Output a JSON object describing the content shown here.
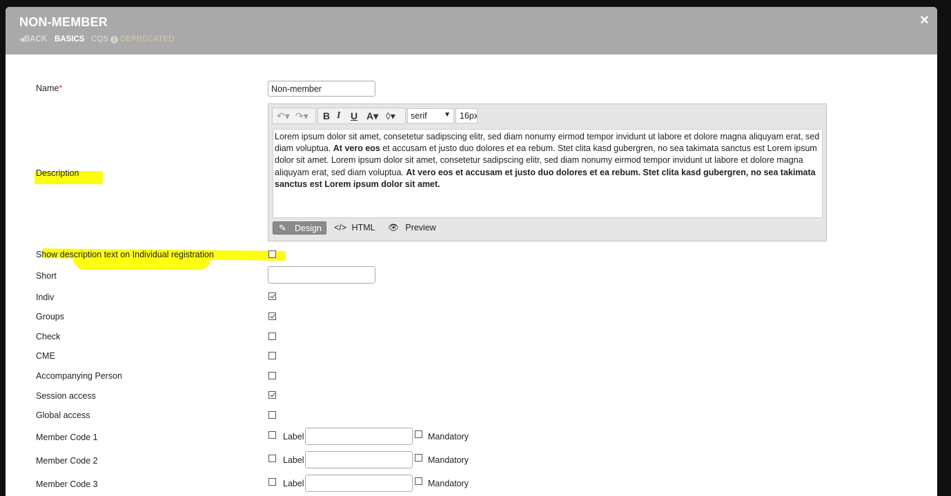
{
  "modal": {
    "title": "NON-MEMBER",
    "close_symbol": "×",
    "nav": {
      "back": "BACK",
      "basics": "BASICS",
      "cqs": "CQS",
      "info_icon": "i",
      "deprecated": "DEPRECATED"
    }
  },
  "form": {
    "name_label": "Name",
    "name_required": "*",
    "name_value": "Non-member",
    "description_label": "Description",
    "show_description_label": "Show description text on Individual registration",
    "short_label": "Short",
    "short_value": "",
    "checkboxes": [
      {
        "label": "Indiv",
        "checked": true
      },
      {
        "label": "Groups",
        "checked": true
      },
      {
        "label": "Check",
        "checked": false
      },
      {
        "label": "CME",
        "checked": false
      },
      {
        "label": "Accompanying Person",
        "checked": false
      },
      {
        "label": "Session access",
        "checked": true
      },
      {
        "label": "Global access",
        "checked": false
      }
    ],
    "member_codes": [
      {
        "label": "Member Code 1",
        "sub_label": "Label",
        "mandatory": "Mandatory",
        "value": ""
      },
      {
        "label": "Member Code 2",
        "sub_label": "Label",
        "mandatory": "Mandatory",
        "value": ""
      },
      {
        "label": "Member Code 3",
        "sub_label": "Label",
        "mandatory": "Mandatory",
        "value": ""
      }
    ]
  },
  "editor": {
    "font_family": "serif",
    "font_size": "16px",
    "text_plain_1": "Lorem ipsum dolor sit amet, consetetur sadipscing elitr, sed diam nonumy eirmod tempor invidunt ut labore et dolore magna aliquyam erat, sed diam voluptua. ",
    "text_bold_1": "At vero eos",
    "text_plain_2": " et accusam et justo duo dolores et ea rebum. Stet clita kasd gubergren, no sea takimata sanctus est Lorem ipsum dolor sit amet. Lorem ipsum dolor sit amet, consetetur sadipscing elitr, sed diam nonumy eirmod tempor invidunt ut labore et dolore magna aliquyam erat, sed diam voluptua. ",
    "text_bold_2": "At vero eos et accusam et justo duo dolores et ea rebum. Stet clita kasd gubergren, no sea takimata sanctus est Lorem ipsum dolor sit amet.",
    "modes": {
      "design": "Design",
      "html": "HTML",
      "preview": "Preview"
    }
  },
  "colors": {
    "header_bg": "#a9a9a9",
    "highlight": "#fdfd12",
    "required": "#d32f2f"
  }
}
